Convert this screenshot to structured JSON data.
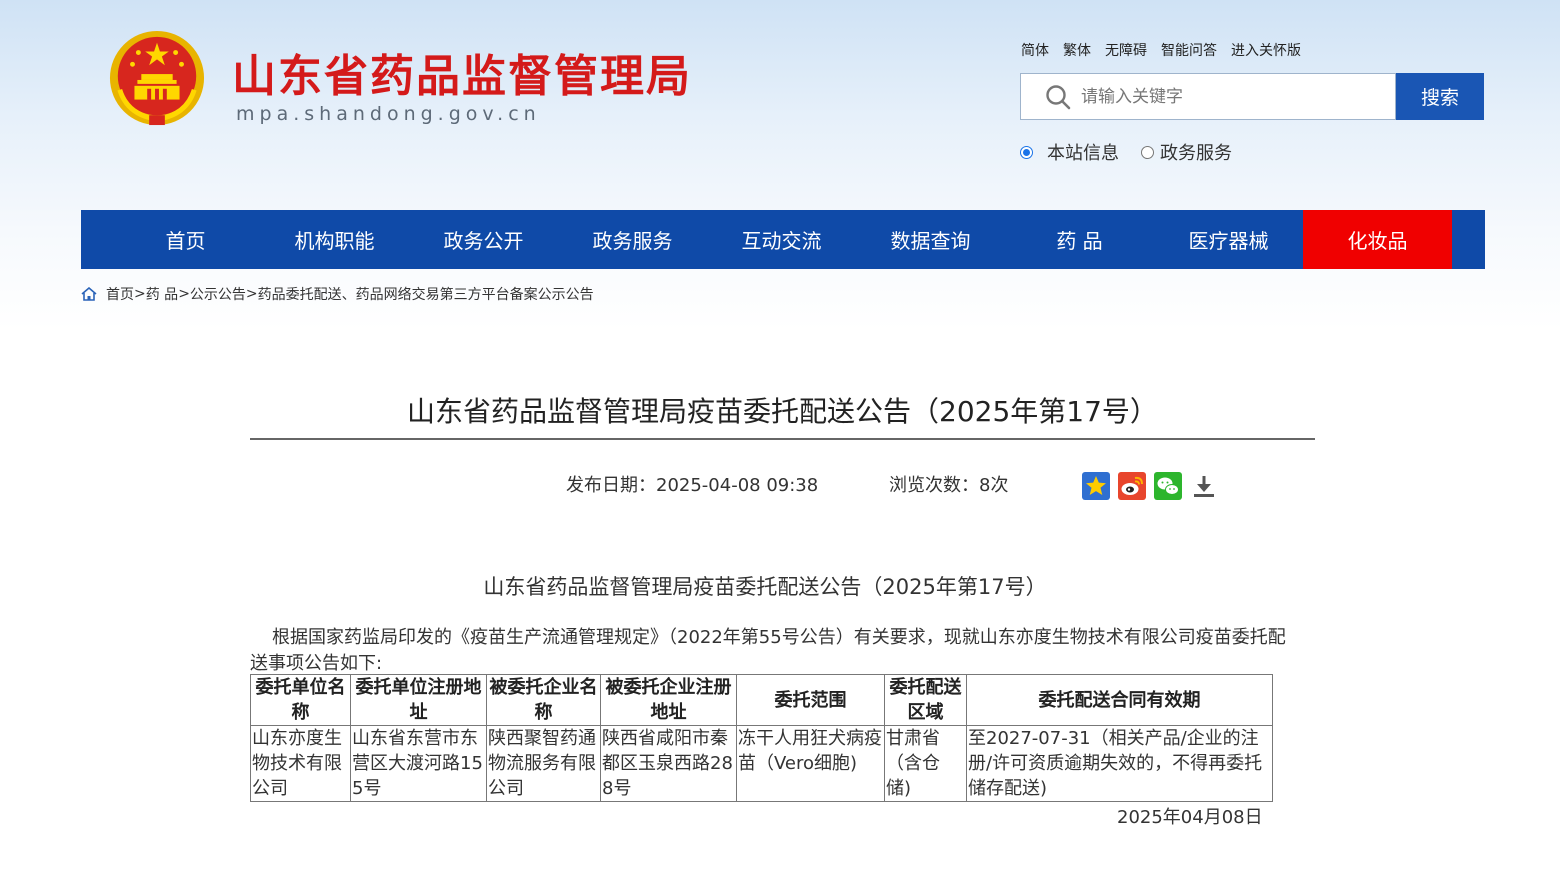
{
  "header": {
    "site_title": "山东省药品监督管理局",
    "site_domain": "mpa.shandong.gov.cn",
    "top_links": [
      "简体",
      "繁体",
      "无障碍",
      "智能问答",
      "进入关怀版"
    ],
    "search": {
      "placeholder": "请输入关键字",
      "button": "搜索"
    },
    "scope_options": [
      {
        "label": "本站信息",
        "selected": true
      },
      {
        "label": "政务服务",
        "selected": false
      }
    ]
  },
  "nav": {
    "items": [
      "首页",
      "机构职能",
      "政务公开",
      "政务服务",
      "互动交流",
      "数据查询",
      "药 品",
      "医疗器械",
      "化妆品"
    ],
    "active_color": "#f00000",
    "bar_color": "#0f4aa8"
  },
  "breadcrumb": {
    "items": [
      "首页",
      "药 品",
      "公示公告",
      "药品委托配送、药品网络交易第三方平台备案公示公告"
    ],
    "separator": ">"
  },
  "article": {
    "title": "山东省药品监督管理局疫苗委托配送公告（2025年第17号）",
    "publish_label": "发布日期：",
    "publish_date": "2025-04-08 09:38",
    "views_label": "浏览次数：",
    "views": "8次",
    "share_icons": [
      "favorite-star-icon",
      "weibo-icon",
      "wechat-icon",
      "download-icon"
    ],
    "sub_title": "山东省药品监督管理局疫苗委托配送公告（2025年第17号）",
    "intro": "根据国家药监局印发的《疫苗生产流通管理规定》（2022年第55号公告）有关要求，现就山东亦度生物技术有限公司疫苗委托配送事项公告如下:",
    "table": {
      "headers": [
        "委托单位名称",
        "委托单位注册地址",
        "被委托企业名称",
        "被委托企业注册地址",
        "委托范围",
        "委托配送区域",
        "委托配送合同有效期"
      ],
      "rows": [
        [
          "山东亦度生物技术有限公司",
          "山东省东营市东营区大渡河路155号",
          "陕西聚智药通物流服务有限公司",
          "陕西省咸阳市秦都区玉泉西路288号",
          "冻干人用狂犬病疫苗（Vero细胞)",
          "甘肃省（含仓储)",
          "至2027-07-31（相关产品/企业的注册/许可资质逾期失效的，不得再委托储存配送)"
        ]
      ]
    },
    "sign_date": "2025年04月08日"
  }
}
